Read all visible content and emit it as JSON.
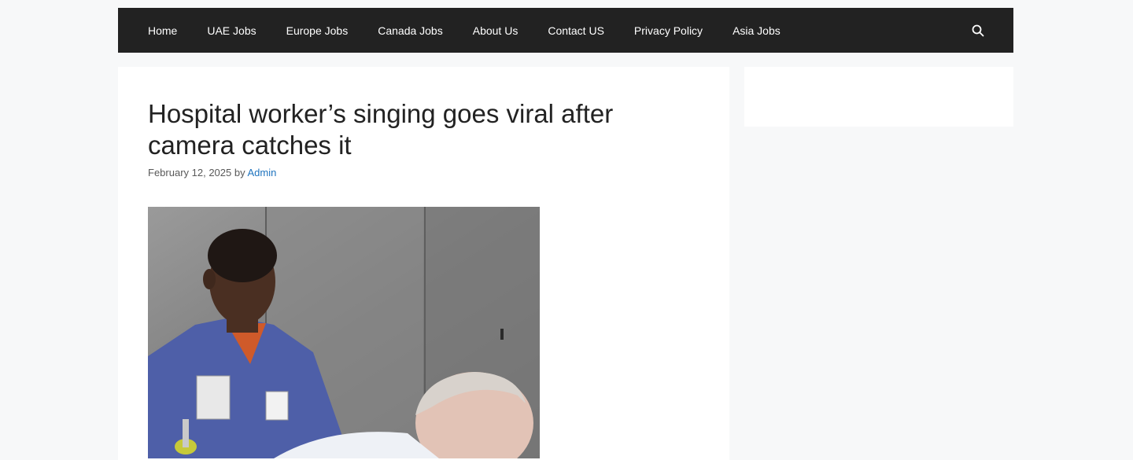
{
  "nav": {
    "items": [
      {
        "label": "Home"
      },
      {
        "label": "UAE Jobs"
      },
      {
        "label": "Europe Jobs"
      },
      {
        "label": "Canada Jobs"
      },
      {
        "label": "About Us"
      },
      {
        "label": "Contact US"
      },
      {
        "label": "Privacy Policy"
      },
      {
        "label": "Asia Jobs"
      }
    ],
    "search_icon": "search-icon"
  },
  "article": {
    "title": "Hospital worker’s singing goes viral after camera catches it",
    "date": "February 12, 2025",
    "by": "by",
    "author": "Admin"
  },
  "colors": {
    "nav_bg": "#222222",
    "page_bg": "#f7f8f9",
    "link": "#1e73be"
  }
}
